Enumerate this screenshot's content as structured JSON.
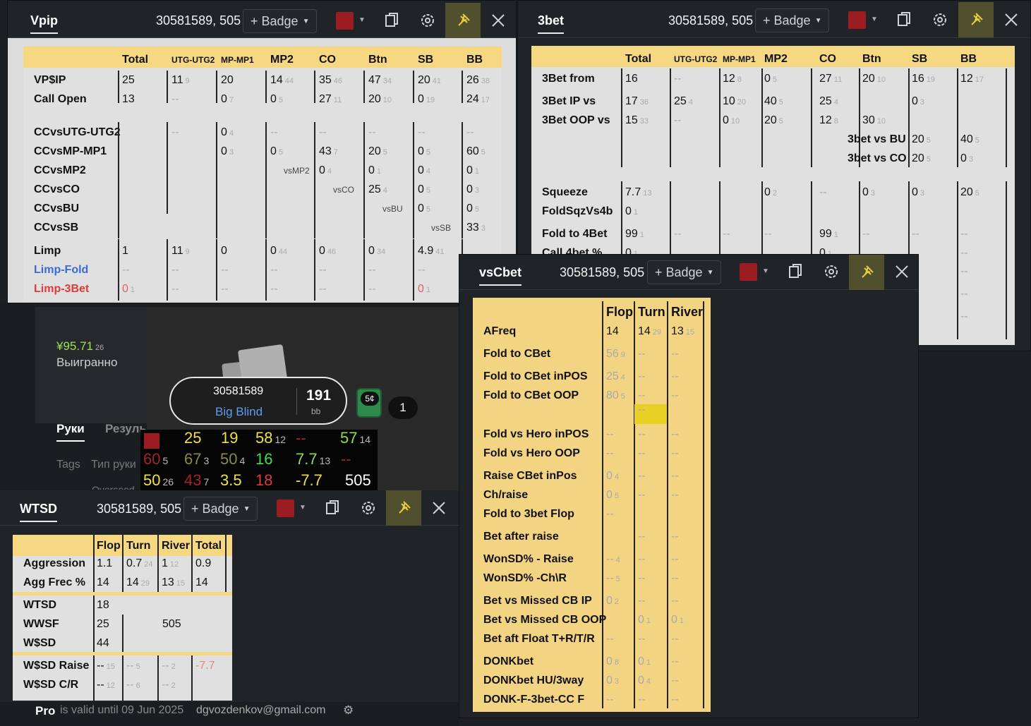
{
  "vpip": {
    "title": "Vpip",
    "player": "30581589, 505",
    "badge": "+ Badge",
    "cols": [
      "Total",
      "UTG-UTG2",
      "MP-MP1",
      "MP2",
      "CO",
      "Btn",
      "SB",
      "BB"
    ],
    "rows": [
      {
        "label": "VP$IP",
        "cells": [
          [
            "25",
            ""
          ],
          [
            "11",
            "9"
          ],
          [
            "20",
            ""
          ],
          [
            "14",
            "44"
          ],
          [
            "35",
            "46"
          ],
          [
            "47",
            "34"
          ],
          [
            "20",
            "41"
          ],
          [
            "26",
            "38"
          ]
        ]
      },
      {
        "label": "Call Open",
        "cells": [
          [
            "13",
            ""
          ],
          [
            "--",
            ""
          ],
          [
            "0",
            "7"
          ],
          [
            "0",
            "5"
          ],
          [
            "27",
            "11"
          ],
          [
            "20",
            "10"
          ],
          [
            "0",
            "19"
          ],
          [
            "24",
            "17"
          ]
        ]
      }
    ],
    "ccrows": [
      {
        "label": "CCvsUTG-UTG2",
        "inner": "",
        "cells": [
          [
            "--",
            ""
          ],
          [
            "0",
            "4"
          ],
          [
            "--",
            ""
          ],
          [
            "--",
            ""
          ],
          [
            "--",
            ""
          ],
          [
            "--",
            ""
          ],
          [
            "--",
            ""
          ]
        ]
      },
      {
        "label": "CCvsMP-MP1",
        "inner": "",
        "cells": [
          [
            "0",
            "3"
          ],
          [
            "0",
            "5"
          ],
          [
            "43",
            "7"
          ],
          [
            "20",
            "5"
          ],
          [
            "0",
            "5"
          ],
          [
            "60",
            "5"
          ]
        ]
      },
      {
        "label": "CCvsMP2",
        "inner": "vsMP2",
        "cells": [
          [
            "0",
            "4"
          ],
          [
            "0",
            "1"
          ],
          [
            "0",
            "4"
          ],
          [
            "0",
            "1"
          ]
        ]
      },
      {
        "label": "CCvsCO",
        "inner": "vsCO",
        "cells": [
          [
            "25",
            "4"
          ],
          [
            "0",
            "5"
          ],
          [
            "0",
            "3"
          ]
        ]
      },
      {
        "label": "CCvsBU",
        "inner": "vsBU",
        "cells": [
          [
            "0",
            "5"
          ],
          [
            "0",
            "5"
          ]
        ]
      },
      {
        "label": "CCvsSB",
        "inner": "vsSB",
        "cells": [
          [
            "33",
            "3"
          ]
        ]
      }
    ],
    "limp": [
      {
        "label": "Limp",
        "cells": [
          [
            "1",
            ""
          ],
          [
            "11",
            "9"
          ],
          [
            "0",
            ""
          ],
          [
            "0",
            "44"
          ],
          [
            "0",
            "46"
          ],
          [
            "0",
            "34"
          ],
          [
            "4.9",
            "41"
          ],
          [
            "",
            ""
          ]
        ]
      },
      {
        "label": "Limp-Fold",
        "cells": [
          [
            "--",
            ""
          ],
          [
            "--",
            ""
          ],
          [
            "--",
            ""
          ],
          [
            "--",
            ""
          ],
          [
            "--",
            ""
          ],
          [
            "--",
            ""
          ],
          [
            "--",
            ""
          ],
          [
            "",
            ""
          ]
        ]
      },
      {
        "label": "Limp-3Bet",
        "cells": [
          [
            "0",
            "1"
          ],
          [
            "--",
            ""
          ],
          [
            "--",
            ""
          ],
          [
            "--",
            ""
          ],
          [
            "--",
            ""
          ],
          [
            "--",
            ""
          ],
          [
            "0",
            "1"
          ],
          [
            "",
            ""
          ]
        ]
      }
    ]
  },
  "threebet": {
    "title": "3bet",
    "player": "30581589, 505",
    "badge": "+ Badge",
    "cols": [
      "Total",
      "UTG-UTG2",
      "MP-MP1",
      "MP2",
      "CO",
      "Btn",
      "SB",
      "BB"
    ],
    "rows": [
      {
        "label": "3Bet from",
        "cells": [
          [
            "16",
            ""
          ],
          [
            "--",
            ""
          ],
          [
            "12",
            "8"
          ],
          [
            "0",
            "5"
          ],
          [
            "27",
            "11"
          ],
          [
            "20",
            "10"
          ],
          [
            "16",
            "19"
          ],
          [
            "12",
            "17"
          ]
        ]
      },
      {
        "label": "3Bet IP vs",
        "cells": [
          [
            "17",
            "36"
          ],
          [
            "25",
            "4"
          ],
          [
            "10",
            "20"
          ],
          [
            "40",
            "5"
          ],
          [
            "25",
            "4"
          ],
          [
            "",
            ""
          ],
          [
            "0",
            "3"
          ],
          [
            "",
            ""
          ]
        ]
      },
      {
        "label": "3Bet OOP vs",
        "cells": [
          [
            "15",
            "33"
          ],
          [
            "--",
            ""
          ],
          [
            "0",
            "10"
          ],
          [
            "20",
            "5"
          ],
          [
            "12",
            "8"
          ],
          [
            "30",
            "10"
          ],
          [
            "",
            ""
          ],
          [
            "",
            ""
          ]
        ]
      }
    ],
    "vsrows": [
      {
        "label": "3bet vs BU",
        "a": [
          "20",
          "5"
        ],
        "b": [
          "40",
          "5"
        ]
      },
      {
        "label": "3bet vs CO",
        "a": [
          "20",
          "5"
        ],
        "b": [
          "0",
          "3"
        ]
      }
    ],
    "sq": [
      {
        "label": "Squeeze",
        "cells": [
          [
            "7.7",
            "13"
          ],
          [
            "",
            ""
          ],
          [
            "",
            ""
          ],
          [
            "0",
            "2"
          ],
          [
            "--",
            ""
          ],
          [
            "0",
            "3"
          ],
          [
            "0",
            "3"
          ],
          [
            "20",
            "5"
          ]
        ]
      },
      {
        "label": "FoldSqzVs4b",
        "cells": [
          [
            "0",
            "1"
          ],
          [
            "",
            ""
          ],
          [
            "",
            ""
          ],
          [
            "",
            ""
          ],
          [
            "",
            ""
          ],
          [
            "",
            ""
          ],
          [
            "",
            ""
          ],
          [
            "",
            ""
          ]
        ]
      },
      {
        "label": "Fold to 4Bet",
        "cells": [
          [
            "99",
            "1"
          ],
          [
            "--",
            ""
          ],
          [
            "--",
            ""
          ],
          [
            "--",
            ""
          ],
          [
            "99",
            "1"
          ],
          [
            "--",
            ""
          ],
          [
            "--",
            ""
          ],
          [
            "--",
            ""
          ]
        ]
      },
      {
        "label": "Call 4bet %",
        "cells": [
          [
            "0",
            "1"
          ],
          [
            "",
            ""
          ],
          [
            "",
            ""
          ],
          [
            "",
            ""
          ],
          [
            "0",
            "1"
          ],
          [
            "",
            ""
          ],
          [
            "",
            ""
          ],
          [
            "--",
            ""
          ]
        ]
      }
    ],
    "extra": [
      "--",
      "--",
      "1",
      "--"
    ]
  },
  "app": {
    "amount": "¥95.71",
    "amount_n": "26",
    "won": "Выигранно",
    "tab_hands": "Руки",
    "tab_results": "Резуль",
    "tags": "Tags",
    "hand_type": "Тип руки",
    "cut": "Overseed",
    "seat_id": "30581589",
    "seat_pos": "Big Blind",
    "stack": "191",
    "stack_unit": "bb",
    "chip": "5¢",
    "count": "1",
    "pro": "Pro",
    "valid": "is valid until 09 Jun 2025",
    "email": "dgvozdenkov@gmail.com"
  },
  "hud": [
    [
      {
        "v": "25",
        "c": "#f0e04a"
      },
      {
        "v": "19",
        "c": "#f0e04a"
      },
      {
        "v": "58",
        "n": "12",
        "c": "#f0e04a"
      },
      {
        "v": "--",
        "c": "#a52424"
      },
      {
        "v": "57",
        "n": "14",
        "c": "#8be04a"
      }
    ],
    [
      {
        "v": "60",
        "n": "5",
        "c": "#a52424"
      },
      {
        "v": "67",
        "n": "3",
        "c": "#8a8a45"
      },
      {
        "v": "50",
        "n": "4",
        "c": "#8a8a45"
      },
      {
        "v": "16",
        "c": "#43e043"
      },
      {
        "v": "7.7",
        "n": "13",
        "c": "#8be04a"
      },
      {
        "v": "--",
        "c": "#a52424"
      }
    ],
    [
      {
        "v": "50",
        "n": "26",
        "c": "#f0e04a"
      },
      {
        "v": "43",
        "n": "7",
        "c": "#a52424"
      },
      {
        "v": "3.5",
        "c": "#f0e04a"
      },
      {
        "v": "18",
        "c": "#e03b3b"
      },
      {
        "v": "-7.7",
        "c": "#f0e04a"
      },
      {
        "v": "505",
        "c": "#ffffff"
      }
    ]
  ],
  "wtsd": {
    "title": "WTSD",
    "player": "30581589, 505",
    "badge": "+ Badge",
    "cols": [
      "Flop",
      "Turn",
      "River",
      "Total"
    ],
    "r1": [
      {
        "label": "Aggression",
        "cells": [
          [
            "1.1",
            ""
          ],
          [
            "0.7",
            "24"
          ],
          [
            "1",
            "12"
          ],
          [
            "0.9",
            ""
          ]
        ]
      },
      {
        "label": "Agg Frec %",
        "cells": [
          [
            "14",
            ""
          ],
          [
            "14",
            "29"
          ],
          [
            "13",
            "15"
          ],
          [
            "14",
            ""
          ]
        ]
      }
    ],
    "r2": [
      {
        "label": "WTSD",
        "v": "18"
      },
      {
        "label": "WWSF",
        "v": "25"
      },
      {
        "label": "W$SD",
        "v": "44"
      }
    ],
    "mid": "505",
    "r3": [
      {
        "label": "W$SD Raise",
        "cells": [
          [
            "--",
            "15"
          ],
          [
            "--",
            "5"
          ],
          [
            "--",
            "2"
          ],
          [
            "-7.7",
            ""
          ]
        ]
      },
      {
        "label": "W$SD C/R",
        "cells": [
          [
            "--",
            "12"
          ],
          [
            "--",
            "6"
          ],
          [
            "--",
            "2"
          ],
          [
            "",
            ""
          ]
        ]
      }
    ]
  },
  "vscbet": {
    "title": "vsCbet",
    "player": "30581589, 505",
    "badge": "+ Badge",
    "cols": [
      "Flop",
      "Turn",
      "River"
    ],
    "rows": [
      {
        "label": "AFreq",
        "c": [
          [
            "14",
            ""
          ],
          [
            "14",
            "29"
          ],
          [
            "13",
            "15"
          ]
        ]
      },
      {
        "label": "Fold to CBet",
        "c": [
          [
            "56",
            "9"
          ],
          [
            "--",
            ""
          ],
          [
            "--",
            ""
          ]
        ]
      },
      {
        "label": "Fold to CBet inPOS",
        "c": [
          [
            "25",
            "4"
          ],
          [
            "--",
            ""
          ],
          [
            "--",
            ""
          ]
        ]
      },
      {
        "label": "Fold to CBet OOP",
        "c": [
          [
            "80",
            "5"
          ],
          [
            "--",
            ""
          ],
          [
            "--",
            ""
          ]
        ]
      },
      {
        "label": "",
        "c": [
          [
            "",
            ""
          ],
          [
            "--",
            ""
          ],
          [
            "",
            ""
          ]
        ]
      },
      {
        "label": "Fold vs Hero inPOS",
        "c": [
          [
            "--",
            ""
          ],
          [
            "--",
            ""
          ],
          [
            "--",
            ""
          ]
        ]
      },
      {
        "label": "Fold vs Hero OOP",
        "c": [
          [
            "--",
            ""
          ],
          [
            "--",
            ""
          ],
          [
            "--",
            ""
          ]
        ]
      },
      {
        "label": "Raise CBet inPos",
        "c": [
          [
            "0",
            "4"
          ],
          [
            "--",
            ""
          ],
          [
            "--",
            ""
          ]
        ]
      },
      {
        "label": "Ch/raise",
        "c": [
          [
            "0",
            "5"
          ],
          [
            "--",
            ""
          ],
          [
            "--",
            ""
          ]
        ]
      },
      {
        "label": "Fold to 3bet Flop",
        "c": [
          [
            "--",
            ""
          ],
          [
            "",
            ""
          ],
          [
            "",
            ""
          ]
        ]
      },
      {
        "label": "Bet after raise",
        "c": [
          [
            "",
            ""
          ],
          [
            "--",
            ""
          ],
          [
            "--",
            ""
          ]
        ]
      },
      {
        "label": "WonSD% - Raise",
        "c": [
          [
            "--",
            "4"
          ],
          [
            "--",
            ""
          ],
          [
            "--",
            ""
          ]
        ]
      },
      {
        "label": "WonSD% -Ch\\R",
        "c": [
          [
            "--",
            "5"
          ],
          [
            "--",
            ""
          ],
          [
            "--",
            ""
          ]
        ]
      },
      {
        "label": "Bet vs Missed CB IP",
        "c": [
          [
            "0",
            "2"
          ],
          [
            "--",
            ""
          ],
          [
            "--",
            ""
          ]
        ]
      },
      {
        "label": "Bet vs Missed CB OOP",
        "c": [
          [
            "",
            ""
          ],
          [
            "0",
            "1"
          ],
          [
            "0",
            "1"
          ]
        ]
      },
      {
        "label": "Bet aft Float T+R/T/R",
        "c": [
          [
            "--",
            ""
          ],
          [
            "--",
            ""
          ],
          [
            "--",
            ""
          ]
        ]
      },
      {
        "label": "DONKbet",
        "c": [
          [
            "0",
            "8"
          ],
          [
            "0",
            "1"
          ],
          [
            "--",
            ""
          ]
        ]
      },
      {
        "label": "DONKbet HU/3way",
        "c": [
          [
            "0",
            "3"
          ],
          [
            "0",
            "4"
          ],
          [
            "--",
            ""
          ]
        ]
      },
      {
        "label": "DONK-F-3bet-CC F",
        "c": [
          [
            "--",
            ""
          ],
          [
            "--",
            ""
          ],
          [
            "--",
            ""
          ]
        ]
      }
    ]
  },
  "colors": {
    "accent": "#f7d882",
    "swatch": "#9b1c21",
    "pin_bg": "#50502f"
  }
}
